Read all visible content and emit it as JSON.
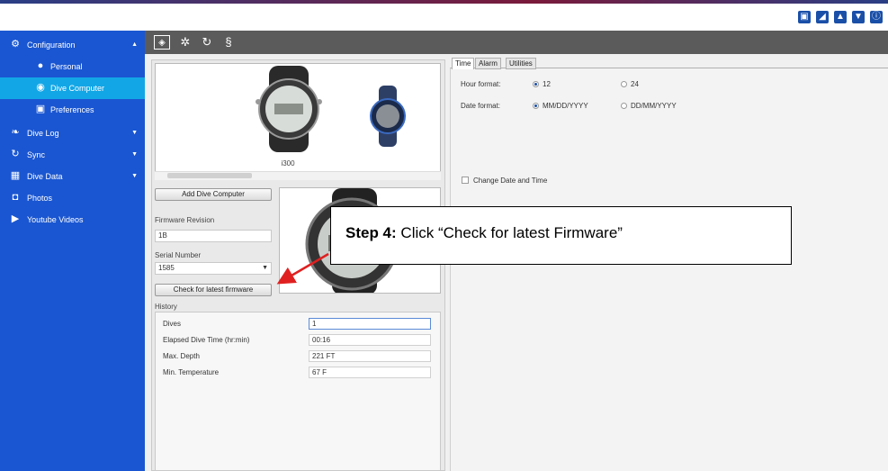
{
  "window": {
    "top_icons": [
      "save-icon",
      "dive-icon",
      "upload-icon",
      "download-icon",
      "info-icon"
    ]
  },
  "sidebar": {
    "items": [
      {
        "label": "Configuration",
        "icon": "gear-icon",
        "arrow": "▲"
      },
      {
        "label": "Personal",
        "icon": "person-icon"
      },
      {
        "label": "Dive Computer",
        "icon": "watch-icon",
        "active": true
      },
      {
        "label": "Preferences",
        "icon": "settings-icon"
      },
      {
        "label": "Dive Log",
        "icon": "book-icon",
        "arrow": "▼"
      },
      {
        "label": "Sync",
        "icon": "sync-icon",
        "arrow": "▼"
      },
      {
        "label": "Dive Data",
        "icon": "data-icon",
        "arrow": "▼"
      },
      {
        "label": "Photos",
        "icon": "camera-icon"
      },
      {
        "label": "Youtube Videos",
        "icon": "video-icon"
      }
    ]
  },
  "toolbar": {
    "icons": [
      "dive-computer-tool-icon",
      "settings-tool-icon",
      "sync-tool-icon",
      "update-tool-icon"
    ]
  },
  "device": {
    "name": "i300",
    "add_button": "Add Dive Computer",
    "firmware_label": "Firmware Revision",
    "firmware_value": "1B",
    "serial_label": "Serial Number",
    "serial_value": "1585",
    "check_button": "Check for latest firmware"
  },
  "history": {
    "label": "History",
    "rows": [
      {
        "label": "Dives",
        "value": "1"
      },
      {
        "label": "Elapsed Dive Time (hr:min)",
        "value": "00:16"
      },
      {
        "label": "Max. Depth",
        "value": "221 FT"
      },
      {
        "label": "Min. Temperature",
        "value": "67 F"
      }
    ]
  },
  "settings": {
    "tabs": [
      "Time",
      "Alarm",
      "Utilities"
    ],
    "hour_format_label": "Hour format:",
    "hour_options": [
      "12",
      "24"
    ],
    "hour_selected": "12",
    "date_format_label": "Date format:",
    "date_options": [
      "MM/DD/YYYY",
      "DD/MM/YYYY"
    ],
    "date_selected": "MM/DD/YYYY",
    "change_datetime_label": "Change Date and Time"
  },
  "annotation": {
    "step": "Step 4:",
    "text": " Click “Check for latest Firmware”",
    "color": "#e02020"
  }
}
